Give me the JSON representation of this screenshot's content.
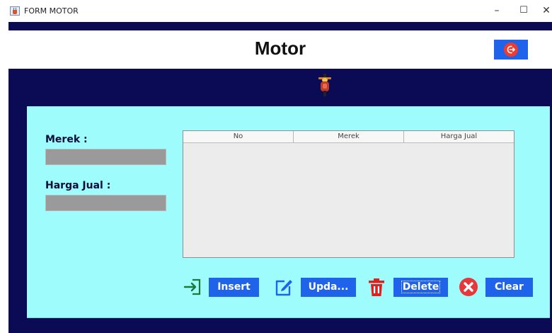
{
  "window": {
    "title": "FORM MOTOR",
    "minimize": "–",
    "maximize": "☐",
    "close": "✕"
  },
  "header": {
    "title": "Motor",
    "exit_icon": "logout-icon"
  },
  "form": {
    "merek_label": "Merek :",
    "merek_value": "",
    "harga_label": "Harga Jual :",
    "harga_value": ""
  },
  "table": {
    "columns": [
      "No",
      "Merek",
      "Harga Jual"
    ],
    "rows": []
  },
  "actions": {
    "insert_label": "Insert",
    "update_label": "Upda...",
    "delete_label": "Delete",
    "clear_label": "Clear"
  },
  "colors": {
    "frame": "#0a0a55",
    "panel": "#9ffcfc",
    "button": "#1e63e9",
    "field": "#9a9a9a"
  }
}
